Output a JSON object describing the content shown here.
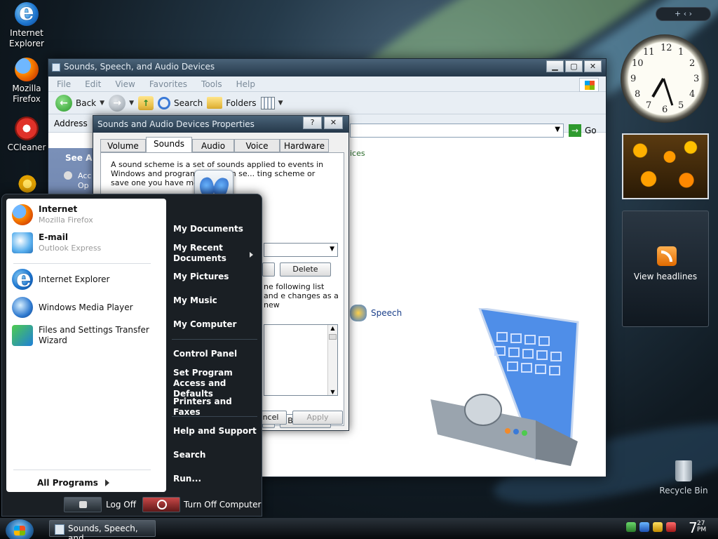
{
  "desktop": {
    "icons": [
      {
        "label": "Internet Explorer"
      },
      {
        "label": "Mozilla Firefox"
      },
      {
        "label": "CCleaner"
      }
    ],
    "recycle_bin": "Recycle Bin"
  },
  "explorer": {
    "title": "Sounds, Speech, and Audio Devices",
    "menu": [
      "File",
      "Edit",
      "View",
      "Favorites",
      "Tools",
      "Help"
    ],
    "toolbar": {
      "back": "Back",
      "search": "Search",
      "folders": "Folders"
    },
    "address_label": "Address",
    "go": "Go",
    "see_also": "See Also",
    "left_item": "Acc Op",
    "devices_link": "ices",
    "speech": "Speech"
  },
  "dialog": {
    "title": "Sounds and Audio Devices Properties",
    "tabs": [
      "Volume",
      "Sounds",
      "Audio",
      "Voice",
      "Hardware"
    ],
    "active_tab": "Sounds",
    "desc": "A sound scheme is a set of sounds applied to events in Windows and programs. You can se... ting scheme or save one you have modified.",
    "mid_text": "ne following list and e changes as a new",
    "delete": "Delete",
    "browse": "Browse...",
    "cancel": "ncel",
    "apply": "Apply"
  },
  "start_menu": {
    "pinned": [
      {
        "title": "Internet",
        "sub": "Mozilla Firefox"
      },
      {
        "title": "E-mail",
        "sub": "Outlook Express"
      }
    ],
    "recent": [
      "Internet Explorer",
      "Windows Media Player",
      "Files and Settings Transfer Wizard"
    ],
    "all_programs": "All Programs",
    "right": [
      "My Documents",
      "My Recent Documents",
      "My Pictures",
      "My Music",
      "My Computer",
      "Control Panel",
      "Set Program Access and Defaults",
      "Printers and Faxes",
      "Help and Support",
      "Search",
      "Run..."
    ],
    "log_off": "Log Off",
    "turn_off": "Turn Off Computer"
  },
  "taskbar": {
    "task": "Sounds, Speech, and...",
    "time": "7",
    "time_minutes": "27",
    "ampm": "PM"
  },
  "sidebar": {
    "controls": "+  ‹  ›",
    "headlines": "View headlines"
  },
  "colors": {
    "accent": "#25384a",
    "start_menu_bg": "#1a1f24",
    "xp_green": "#2e9a2e"
  }
}
